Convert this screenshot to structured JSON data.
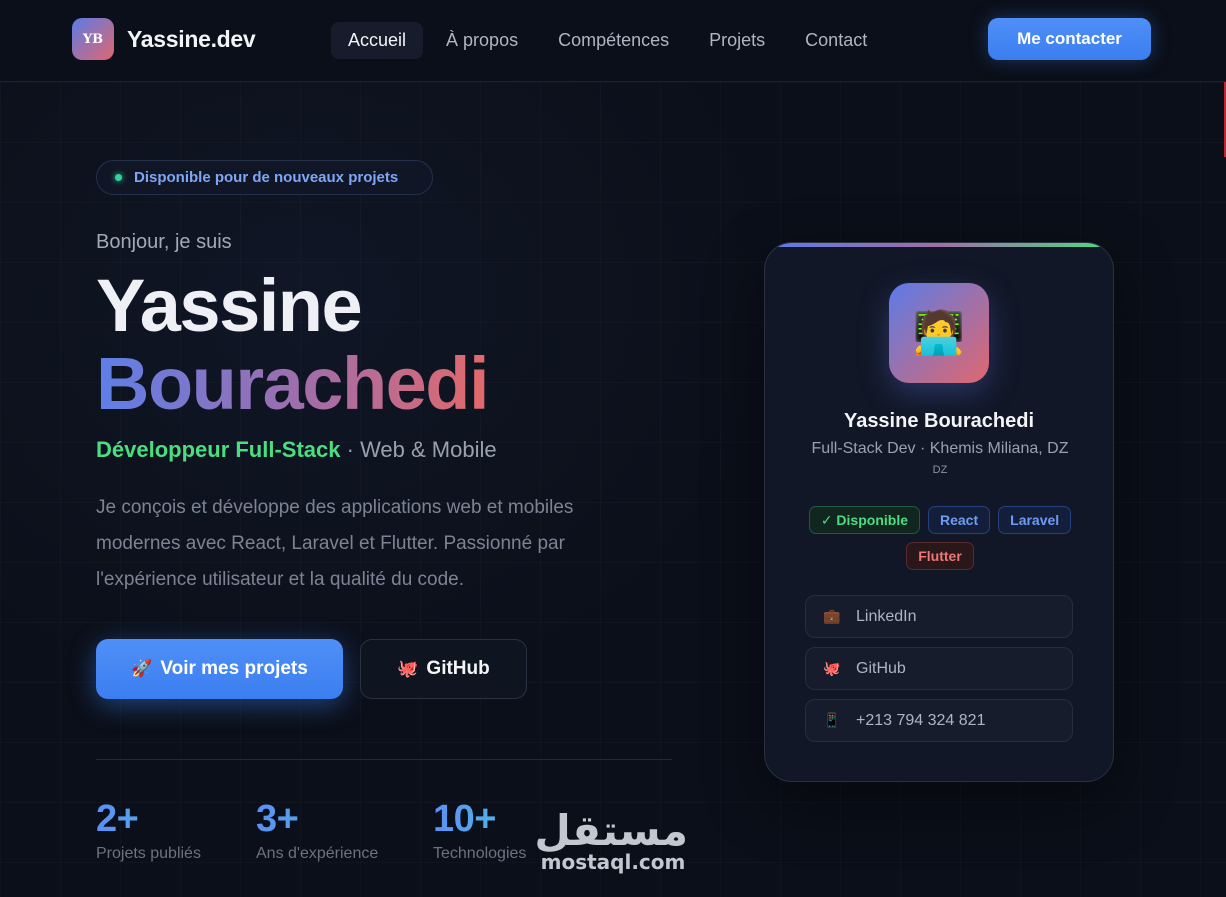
{
  "header": {
    "logo_initials": "YB",
    "logo_text": "Yassine.dev",
    "nav": [
      {
        "label": "Accueil",
        "active": true
      },
      {
        "label": "À propos",
        "active": false
      },
      {
        "label": "Compétences",
        "active": false
      },
      {
        "label": "Projets",
        "active": false
      },
      {
        "label": "Contact",
        "active": false
      }
    ],
    "cta_label": "Me contacter"
  },
  "hero": {
    "availability": "Disponible pour de nouveaux projets",
    "greeting": "Bonjour, je suis",
    "first_name": "Yassine",
    "last_name": "Bourachedi",
    "role_main": "Développeur Full-Stack",
    "role_sub": " · Web & Mobile",
    "bio": "Je conçois et développe des applications web et mobiles modernes avec React, Laravel et Flutter. Passionné par l'expérience utilisateur et la qualité du code.",
    "primary_button": {
      "icon": "🚀",
      "label": "Voir mes projets"
    },
    "secondary_button": {
      "icon": "🐙",
      "label": "GitHub"
    },
    "stats": [
      {
        "value": "2+",
        "label": "Projets publiés"
      },
      {
        "value": "3+",
        "label": "Ans d'expérience"
      },
      {
        "value": "10+",
        "label": "Technologies"
      }
    ]
  },
  "card": {
    "avatar_icon": "🧑‍💻",
    "name": "Yassine Bourachedi",
    "subtitle": "Full-Stack Dev · Khemis Miliana, DZ",
    "country_code": "DZ",
    "tags": [
      {
        "label": "✓ Disponible",
        "variant": "green"
      },
      {
        "label": "React",
        "variant": "blue"
      },
      {
        "label": "Laravel",
        "variant": "blue"
      },
      {
        "label": "Flutter",
        "variant": "red"
      }
    ],
    "links": [
      {
        "icon": "💼",
        "label": "LinkedIn"
      },
      {
        "icon": "🐙",
        "label": "GitHub"
      },
      {
        "icon": "📱",
        "label": "+213 794 324 821"
      }
    ]
  },
  "watermark": {
    "arabic": "مستقل",
    "latin": "mostaql.com"
  },
  "colors": {
    "background": "#0b0f19",
    "accent_blue": "#3b82f6",
    "accent_green": "#4ade80",
    "gradient_start": "#5b7be8",
    "gradient_end": "#e2696a"
  }
}
